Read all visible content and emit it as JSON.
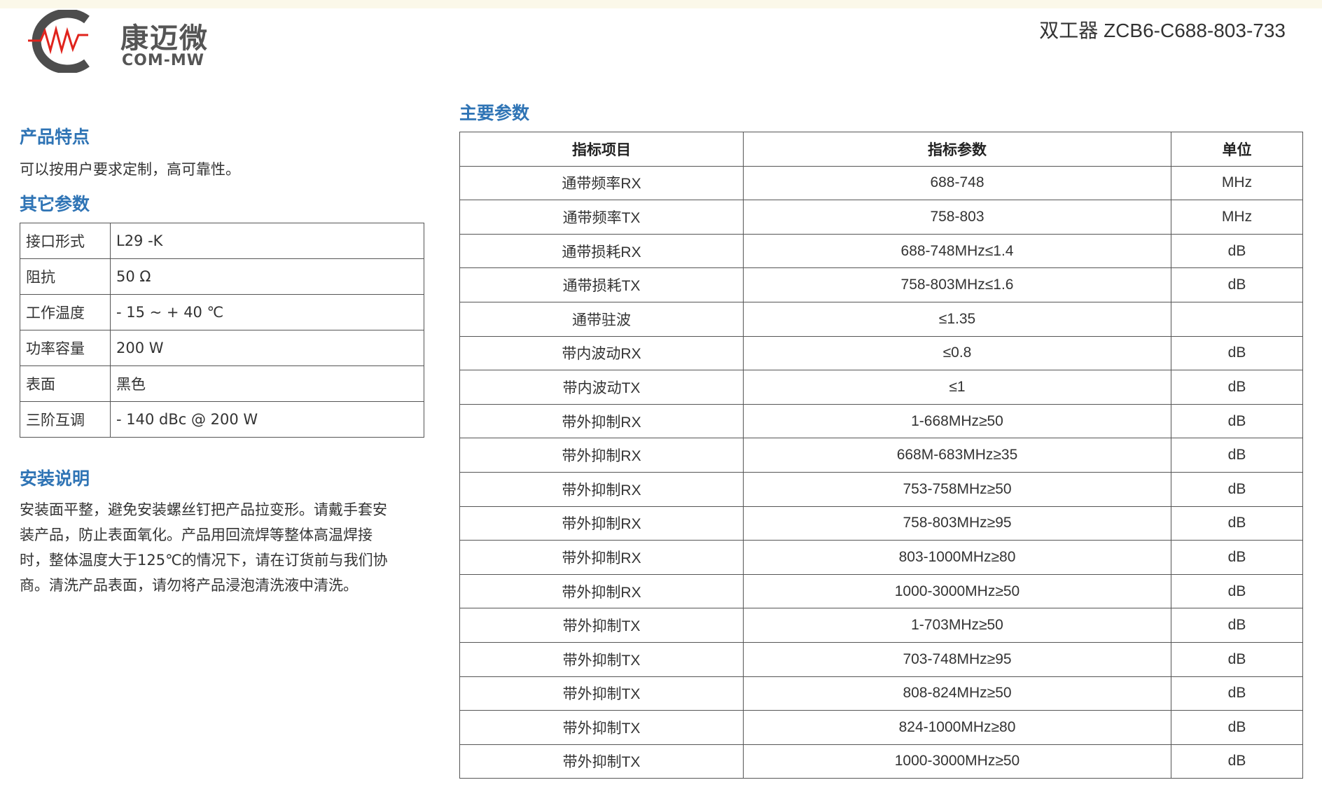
{
  "header": {
    "brand_cn": "康迈微",
    "brand_en": "COM-MW",
    "product_title": "双工器 ZCB6-C688-803-733"
  },
  "features": {
    "title": "产品特点",
    "text": "可以按用户要求定制，高可靠性。"
  },
  "other_params": {
    "title": "其它参数",
    "rows": [
      {
        "key": "接口形式",
        "value": "L29 -K"
      },
      {
        "key": "阻抗",
        "value": "50 Ω"
      },
      {
        "key": "工作温度",
        "value": "- 15 ~ + 40 ℃"
      },
      {
        "key": "功率容量",
        "value": "200 W"
      },
      {
        "key": "表面",
        "value": "黑色"
      },
      {
        "key": "三阶互调",
        "value": "- 140 dBc @ 200 W"
      }
    ]
  },
  "install": {
    "title": "安装说明",
    "lines": [
      "安装面平整，避免安装螺丝钉把产品拉变形。请戴手套安",
      "装产品，防止表面氧化。产品用回流焊等整体高温焊接",
      "时，整体温度大于125℃的情况下，请在订货前与我们协",
      "商。清洗产品表面，请勿将产品浸泡清洗液中清洗。"
    ]
  },
  "main_params": {
    "title": "主要参数",
    "headers": [
      "指标项目",
      "指标参数",
      "单位"
    ],
    "rows": [
      [
        "通带频率RX",
        "688-748",
        "MHz"
      ],
      [
        "通带频率TX",
        "758-803",
        "MHz"
      ],
      [
        "通带损耗RX",
        "688-748MHz≤1.4",
        "dB"
      ],
      [
        "通带损耗TX",
        "758-803MHz≤1.6",
        "dB"
      ],
      [
        "通带驻波",
        "≤1.35",
        ""
      ],
      [
        "带内波动RX",
        "≤0.8",
        "dB"
      ],
      [
        "带内波动TX",
        "≤1",
        "dB"
      ],
      [
        "带外抑制RX",
        "1-668MHz≥50",
        "dB"
      ],
      [
        "带外抑制RX",
        "668M-683MHz≥35",
        "dB"
      ],
      [
        "带外抑制RX",
        "753-758MHz≥50",
        "dB"
      ],
      [
        "带外抑制RX",
        "758-803MHz≥95",
        "dB"
      ],
      [
        "带外抑制RX",
        "803-1000MHz≥80",
        "dB"
      ],
      [
        "带外抑制RX",
        "1000-3000MHz≥50",
        "dB"
      ],
      [
        "带外抑制TX",
        "1-703MHz≥50",
        "dB"
      ],
      [
        "带外抑制TX",
        "703-748MHz≥95",
        "dB"
      ],
      [
        "带外抑制TX",
        "808-824MHz≥50",
        "dB"
      ],
      [
        "带外抑制TX",
        "824-1000MHz≥80",
        "dB"
      ],
      [
        "带外抑制TX",
        "1000-3000MHz≥50",
        "dB"
      ]
    ]
  }
}
